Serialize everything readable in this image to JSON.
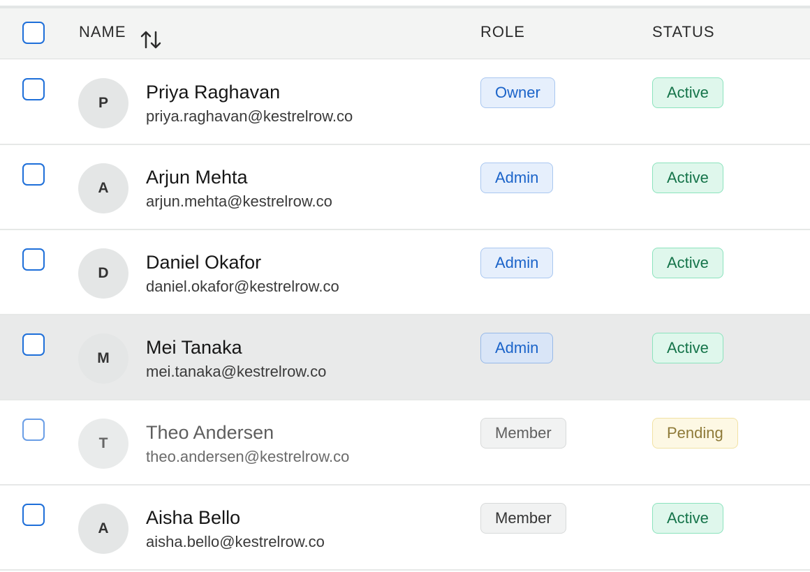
{
  "header": {
    "name_label": "NAME",
    "role_label": "ROLE",
    "status_label": "STATUS",
    "sort_icon": "sort-arrows-icon",
    "select_all_icon": "checkbox"
  },
  "rows": [
    {
      "initial": "P",
      "name": "Priya Raghavan",
      "email": "priya.raghavan@kestrelrow.co",
      "role": "Owner",
      "status": "Active"
    },
    {
      "initial": "A",
      "name": "Arjun Mehta",
      "email": "arjun.mehta@kestrelrow.co",
      "role": "Admin",
      "status": "Active"
    },
    {
      "initial": "D",
      "name": "Daniel Okafor",
      "email": "daniel.okafor@kestrelrow.co",
      "role": "Admin",
      "status": "Active"
    },
    {
      "initial": "M",
      "name": "Mei Tanaka",
      "email": "mei.tanaka@kestrelrow.co",
      "role": "Admin",
      "status": "Active"
    },
    {
      "initial": "T",
      "name": "Theo Andersen",
      "email": "theo.andersen@kestrelrow.co",
      "role": "Member",
      "status": "Pending"
    },
    {
      "initial": "A",
      "name": "Aisha Bello",
      "email": "aisha.bello@kestrelrow.co",
      "role": "Member",
      "status": "Active"
    }
  ],
  "colors": {
    "accent": "#1e6fd9",
    "role_badge_text": "#1a63c9",
    "active_badge_text": "#15744a",
    "pending_badge_text": "#8e7a38",
    "header_background": "#f3f4f3",
    "hover_row_background": "#e9eaea"
  }
}
